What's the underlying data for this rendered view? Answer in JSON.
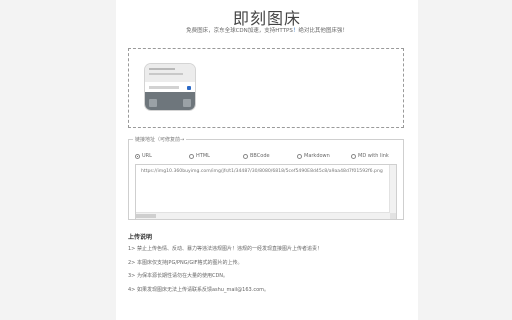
{
  "header": {
    "title": "即刻图床",
    "subtitle_prefix": "免费图床，京东全球CDN加速，支持HTTPS",
    "subtitle_highlight": "！",
    "subtitle_suffix": "绝对比其他图床强！"
  },
  "upload": {
    "preview_image": "uploaded-screenshot-thumbnail"
  },
  "links": {
    "legend": "链接地址（可修复前→",
    "formats": [
      {
        "label": "URL",
        "checked": true
      },
      {
        "label": "HTML",
        "checked": false
      },
      {
        "label": "BBCode",
        "checked": false
      },
      {
        "label": "Markdown",
        "checked": false
      },
      {
        "label": "MD with link",
        "checked": false
      }
    ],
    "url": "https://img10.360buyimg.com/img/jfs/t1/34487/30/8080/6818/5cef5490E8d45c8/a9aa48d7f01592f6.png"
  },
  "notes": {
    "title": "上传说明",
    "items": [
      "1> 禁止上传色情、反动、暴力等违法违规图片！违规的一经发现直接图片上传者追责！",
      "2> 本图床仅支持JPG/PNG/GIF格式的图片的上传。",
      "3> 为保本源长期性请勿在大量的使用CDN。",
      "4> 如果发现图床无法上传请联系反馈ashu_mail@163.com。"
    ]
  }
}
